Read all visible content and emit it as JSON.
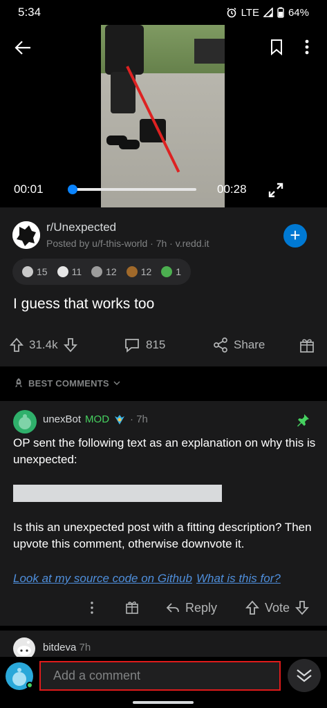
{
  "status_bar": {
    "time": "5:34",
    "network": "LTE",
    "battery": "64%"
  },
  "video": {
    "current_time": "00:01",
    "duration": "00:28",
    "progress": 0.036
  },
  "post": {
    "subreddit": "r/Unexpected",
    "meta": "Posted by u/f-this-world · 7h · v.redd.it",
    "title": "I guess that works too",
    "awards": [
      {
        "icon": "award-silver-icon",
        "count": "15",
        "color": "#c9c9c9"
      },
      {
        "icon": "award-wholesome-icon",
        "count": "11",
        "color": "#e6e6e6"
      },
      {
        "icon": "award-helpful-icon",
        "count": "12",
        "color": "#9c9c9c"
      },
      {
        "icon": "award-poop-icon",
        "count": "12",
        "color": "#a0692a"
      },
      {
        "icon": "award-green-icon",
        "count": "1",
        "color": "#4caf50"
      }
    ],
    "upvotes": "31.4k",
    "comments": "815",
    "share_label": "Share"
  },
  "sort": {
    "label": "BEST COMMENTS"
  },
  "comment": {
    "author": "unexBot",
    "mod_badge": "MOD",
    "time": "· 7h",
    "text1": "OP sent the following text as an explanation on why this is unexpected:",
    "text2": "Is this an unexpected post with a fitting description? Then upvote this comment, otherwise downvote it.",
    "link1": "Look at my source code on Github",
    "link2": "What is this for?",
    "reply_label": "Reply",
    "vote_label": "Vote"
  },
  "next_comment": {
    "author": "bitdeva",
    "time": "7h"
  },
  "comment_bar": {
    "placeholder": "Add a comment"
  },
  "colors": {
    "accent_blue": "#0079d3",
    "mod_green": "#46d160",
    "link_blue": "#4f8fdc",
    "highlight_red": "#e01b1b"
  }
}
